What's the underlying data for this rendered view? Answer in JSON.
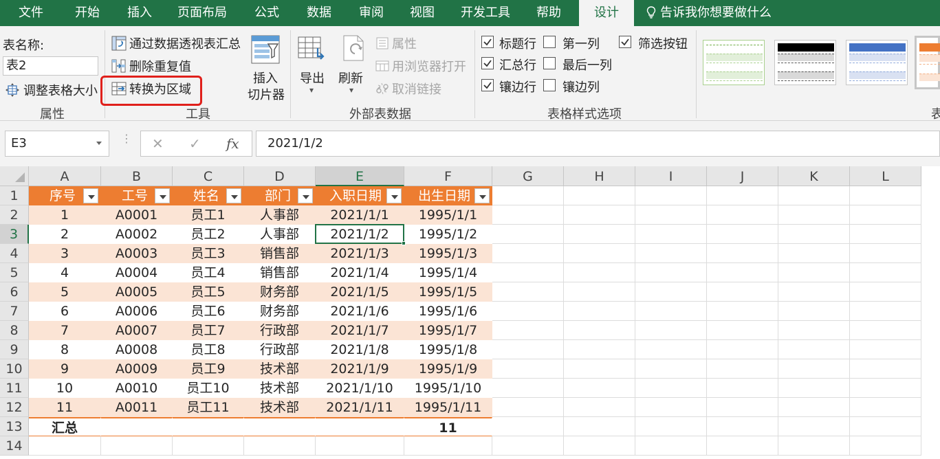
{
  "tabs": [
    "文件",
    "开始",
    "插入",
    "页面布局",
    "公式",
    "数据",
    "审阅",
    "视图",
    "开发工具",
    "帮助",
    "设计"
  ],
  "active_tab": "设计",
  "tell_me": "告诉我你想要做什么",
  "ribbon": {
    "properties": {
      "table_name_label": "表名称:",
      "table_name_value": "表2",
      "resize_label": "调整表格大小",
      "group_label": "属性"
    },
    "tools": {
      "pivot_label": "通过数据透视表汇总",
      "remove_dup_label": "删除重复值",
      "convert_label": "转换为区域",
      "slicer_line1": "插入",
      "slicer_line2": "切片器",
      "group_label": "工具"
    },
    "external": {
      "export_label": "导出",
      "refresh_label": "刷新",
      "properties_label": "属性",
      "open_browser_label": "用浏览器打开",
      "unlink_label": "取消链接",
      "group_label": "外部表数据"
    },
    "style_options": {
      "header_row": "标题行",
      "total_row": "汇总行",
      "banded_rows": "镶边行",
      "first_column": "第一列",
      "last_column": "最后一列",
      "banded_columns": "镶边列",
      "filter_button": "筛选按钮",
      "group_label": "表格样式选项",
      "checked": {
        "header_row": true,
        "total_row": true,
        "banded_rows": true,
        "first_column": false,
        "last_column": false,
        "banded_columns": false,
        "filter_button": true
      }
    },
    "styles_group_label": "表"
  },
  "formula_bar": {
    "cell_ref": "E3",
    "fx_label": "fx",
    "formula": "2021/1/2"
  },
  "sheet": {
    "columns": [
      "A",
      "B",
      "C",
      "D",
      "E",
      "F",
      "G",
      "H",
      "I",
      "J",
      "K",
      "L"
    ],
    "rows": [
      "1",
      "2",
      "3",
      "4",
      "5",
      "6",
      "7",
      "8",
      "9",
      "10",
      "11",
      "12",
      "13",
      "14"
    ],
    "selected_cell": "E3",
    "table_headers": [
      "序号",
      "工号",
      "姓名",
      "部门",
      "入职日期",
      "出生日期"
    ],
    "table_rows": [
      [
        "1",
        "A0001",
        "员工1",
        "人事部",
        "2021/1/1",
        "1995/1/1"
      ],
      [
        "2",
        "A0002",
        "员工2",
        "人事部",
        "2021/1/2",
        "1995/1/2"
      ],
      [
        "3",
        "A0003",
        "员工3",
        "销售部",
        "2021/1/3",
        "1995/1/3"
      ],
      [
        "4",
        "A0004",
        "员工4",
        "销售部",
        "2021/1/4",
        "1995/1/4"
      ],
      [
        "5",
        "A0005",
        "员工5",
        "财务部",
        "2021/1/5",
        "1995/1/5"
      ],
      [
        "6",
        "A0006",
        "员工6",
        "财务部",
        "2021/1/6",
        "1995/1/6"
      ],
      [
        "7",
        "A0007",
        "员工7",
        "行政部",
        "2021/1/7",
        "1995/1/7"
      ],
      [
        "8",
        "A0008",
        "员工8",
        "行政部",
        "2021/1/8",
        "1995/1/8"
      ],
      [
        "9",
        "A0009",
        "员工9",
        "技术部",
        "2021/1/9",
        "1995/1/9"
      ],
      [
        "10",
        "A0010",
        "员工10",
        "技术部",
        "2021/1/10",
        "1995/1/10"
      ],
      [
        "11",
        "A0011",
        "员工11",
        "技术部",
        "2021/1/11",
        "1995/1/11"
      ]
    ],
    "total_row": [
      "汇总",
      "",
      "",
      "",
      "",
      "11"
    ]
  },
  "colors": {
    "excel_green": "#217346",
    "table_header_orange": "#ed7d31",
    "band_peach": "#fbe4d5",
    "highlight_red": "#e0201b"
  }
}
